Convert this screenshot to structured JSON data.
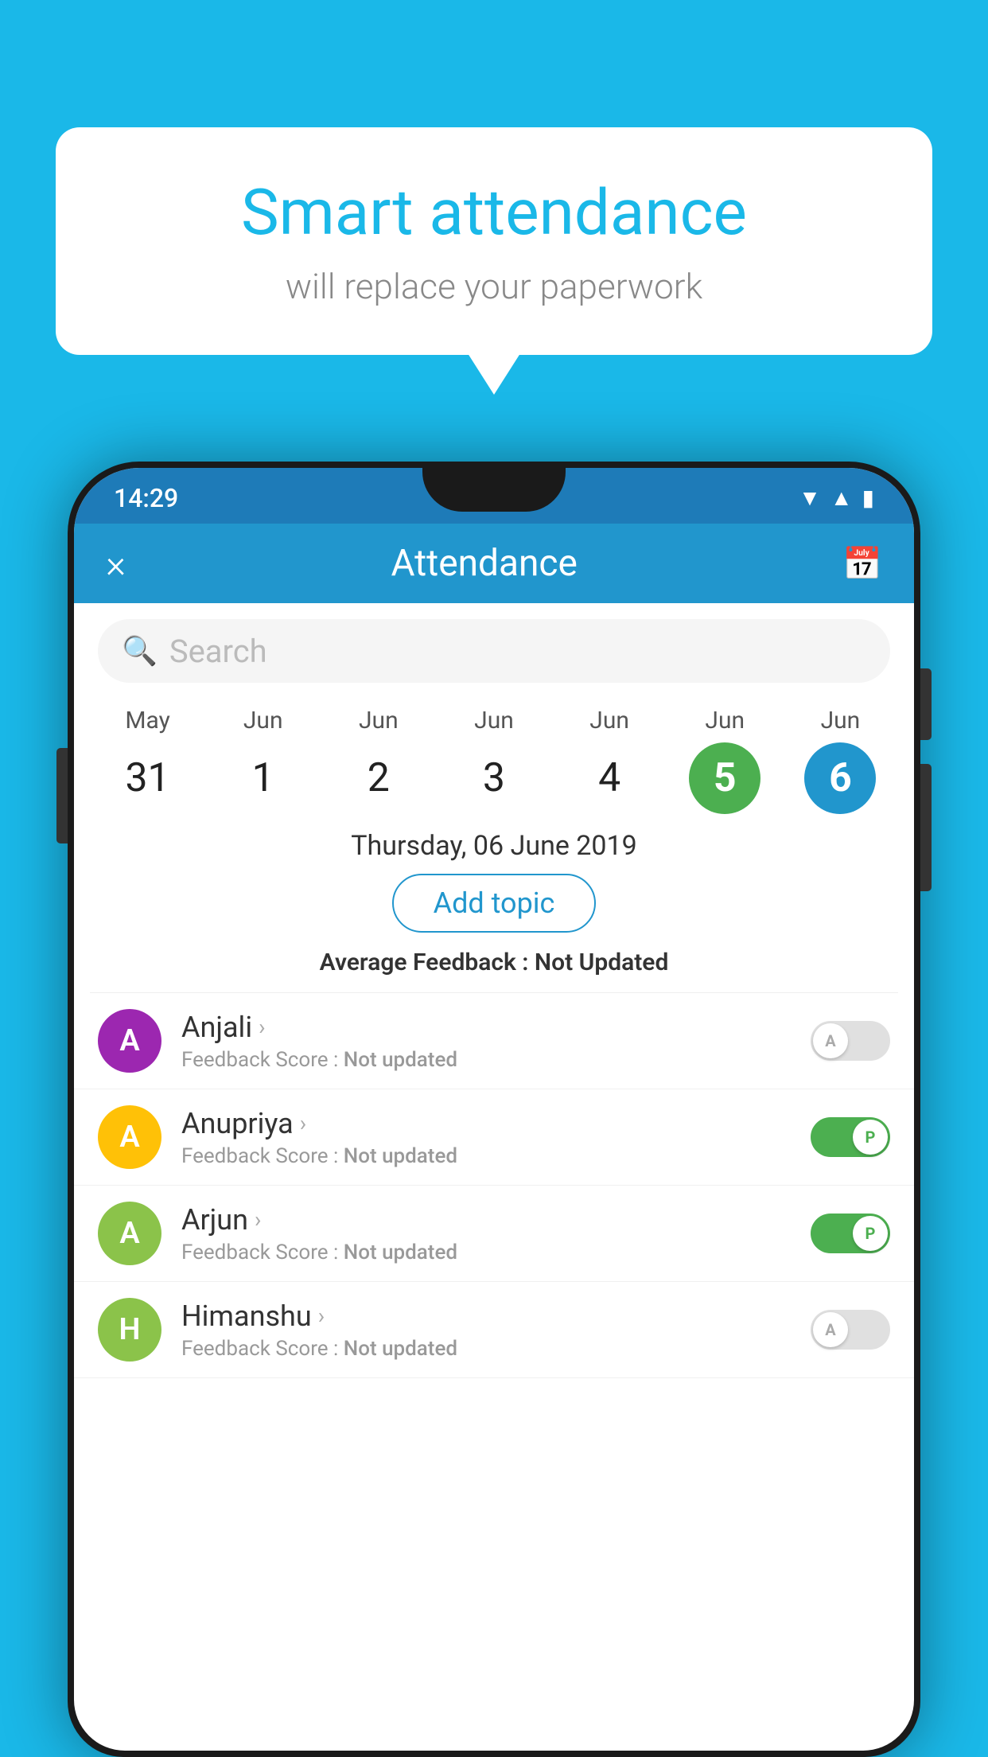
{
  "background_color": "#1ab8e8",
  "bubble": {
    "title": "Smart attendance",
    "subtitle": "will replace your paperwork"
  },
  "status_bar": {
    "time": "14:29",
    "icons": [
      "wifi",
      "signal",
      "battery"
    ]
  },
  "app_header": {
    "title": "Attendance",
    "close_label": "×",
    "calendar_icon": "📅"
  },
  "search": {
    "placeholder": "Search"
  },
  "dates": [
    {
      "month": "May",
      "day": "31",
      "selected": ""
    },
    {
      "month": "Jun",
      "day": "1",
      "selected": ""
    },
    {
      "month": "Jun",
      "day": "2",
      "selected": ""
    },
    {
      "month": "Jun",
      "day": "3",
      "selected": ""
    },
    {
      "month": "Jun",
      "day": "4",
      "selected": ""
    },
    {
      "month": "Jun",
      "day": "5",
      "selected": "green"
    },
    {
      "month": "Jun",
      "day": "6",
      "selected": "blue"
    }
  ],
  "selected_date_label": "Thursday, 06 June 2019",
  "add_topic_label": "Add topic",
  "avg_feedback": {
    "label": "Average Feedback :",
    "value": "Not Updated"
  },
  "students": [
    {
      "name": "Anjali",
      "avatar_letter": "A",
      "avatar_color": "#9c27b0",
      "feedback_label": "Feedback Score :",
      "feedback_value": "Not updated",
      "attendance": "off",
      "toggle_letter": "A"
    },
    {
      "name": "Anupriya",
      "avatar_letter": "A",
      "avatar_color": "#ffc107",
      "feedback_label": "Feedback Score :",
      "feedback_value": "Not updated",
      "attendance": "on",
      "toggle_letter": "P"
    },
    {
      "name": "Arjun",
      "avatar_letter": "A",
      "avatar_color": "#8bc34a",
      "feedback_label": "Feedback Score :",
      "feedback_value": "Not updated",
      "attendance": "on",
      "toggle_letter": "P"
    },
    {
      "name": "Himanshu",
      "avatar_letter": "H",
      "avatar_color": "#8bc34a",
      "feedback_label": "Feedback Score :",
      "feedback_value": "Not updated",
      "attendance": "off",
      "toggle_letter": "A"
    }
  ]
}
